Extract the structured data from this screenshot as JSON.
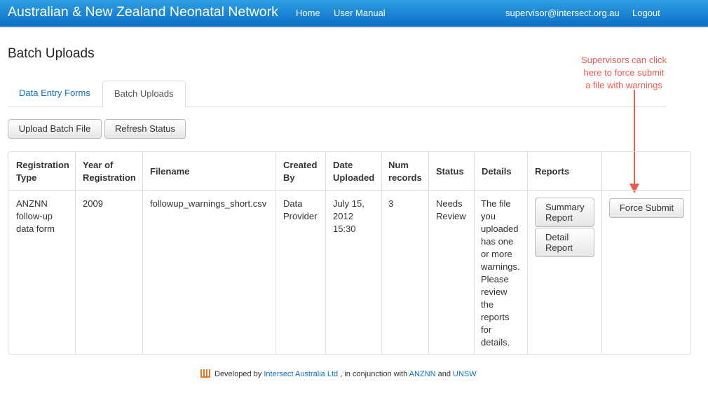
{
  "navbar": {
    "brand": "Australian & New Zealand Neonatal Network",
    "links": [
      "Home",
      "User Manual"
    ],
    "user_email": "supervisor@intersect.org.au",
    "logout": "Logout"
  },
  "page": {
    "title": "Batch Uploads"
  },
  "tabs": [
    {
      "label": "Data Entry Forms",
      "active": false
    },
    {
      "label": "Batch Uploads",
      "active": true
    }
  ],
  "actions": {
    "upload": "Upload Batch File",
    "refresh": "Refresh Status"
  },
  "annotation": [
    "Supervisors can click",
    "here to force submit",
    "a file with warnings"
  ],
  "table": {
    "headers": [
      [
        "Registration",
        "Type"
      ],
      [
        "Year of",
        "Registration"
      ],
      [
        "Filename"
      ],
      [
        "Created",
        "By"
      ],
      [
        "Date",
        "Uploaded"
      ],
      [
        "Num",
        "records"
      ],
      [
        "Status"
      ],
      [
        "Details"
      ],
      [
        "Reports"
      ],
      [
        ""
      ]
    ],
    "row": {
      "registration_type": [
        "ANZNN",
        "follow-up",
        "data form"
      ],
      "year": "2009",
      "filename": "followup_warnings_short.csv",
      "created_by": [
        "Data",
        "Provider"
      ],
      "date_uploaded": [
        "July 15,",
        "2012",
        "15:30"
      ],
      "num_records": "3",
      "status": [
        "Needs",
        "Review"
      ],
      "details": [
        "The file",
        "you",
        "uploaded",
        "has one",
        "or more",
        "warnings.",
        "Please",
        "review",
        "the",
        "reports",
        "for",
        "details."
      ],
      "summary_report": [
        "Summary",
        "Report"
      ],
      "detail_report": [
        "Detail",
        "Report"
      ],
      "force_submit": "Force Submit"
    }
  },
  "footer": {
    "prefix": "Developed by",
    "intersect": "Intersect Australia Ltd",
    "middle": ", in conjunction with",
    "anznn": "ANZNN",
    "and": "and",
    "unsw": "UNSW"
  },
  "colors": {
    "navbar": "#0a6ec4",
    "link": "#0a6ec4",
    "annotation": "#f05a4f",
    "logo": "#e87722"
  }
}
